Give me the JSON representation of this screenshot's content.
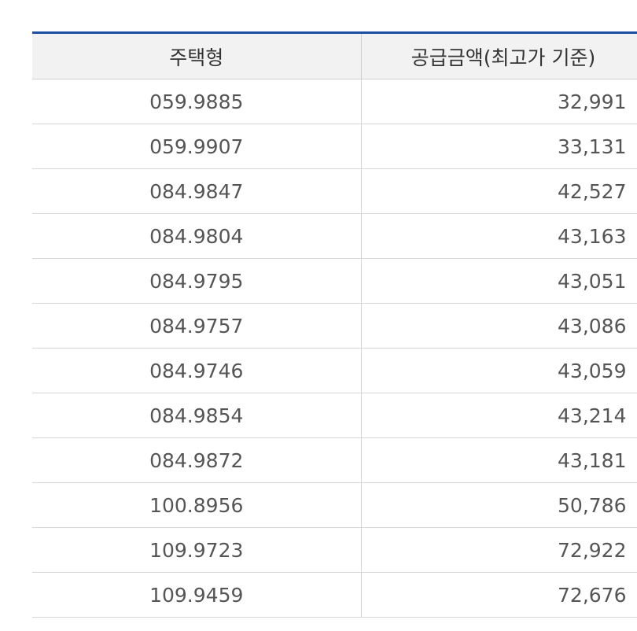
{
  "table": {
    "headers": [
      "주택형",
      "공급금액(최고가 기준)"
    ],
    "rows": [
      {
        "type": "059.9885",
        "price": "32,991"
      },
      {
        "type": "059.9907",
        "price": "33,131"
      },
      {
        "type": "084.9847",
        "price": "42,527"
      },
      {
        "type": "084.9804",
        "price": "43,163"
      },
      {
        "type": "084.9795",
        "price": "43,051"
      },
      {
        "type": "084.9757",
        "price": "43,086"
      },
      {
        "type": "084.9746",
        "price": "43,059"
      },
      {
        "type": "084.9854",
        "price": "43,214"
      },
      {
        "type": "084.9872",
        "price": "43,181"
      },
      {
        "type": "100.8956",
        "price": "50,786"
      },
      {
        "type": "109.9723",
        "price": "72,922"
      },
      {
        "type": "109.9459",
        "price": "72,676"
      }
    ]
  },
  "colors": {
    "header_accent": "#1a4fa3",
    "header_background": "#f2f2f2",
    "grid_line": "#d6d6d6"
  }
}
